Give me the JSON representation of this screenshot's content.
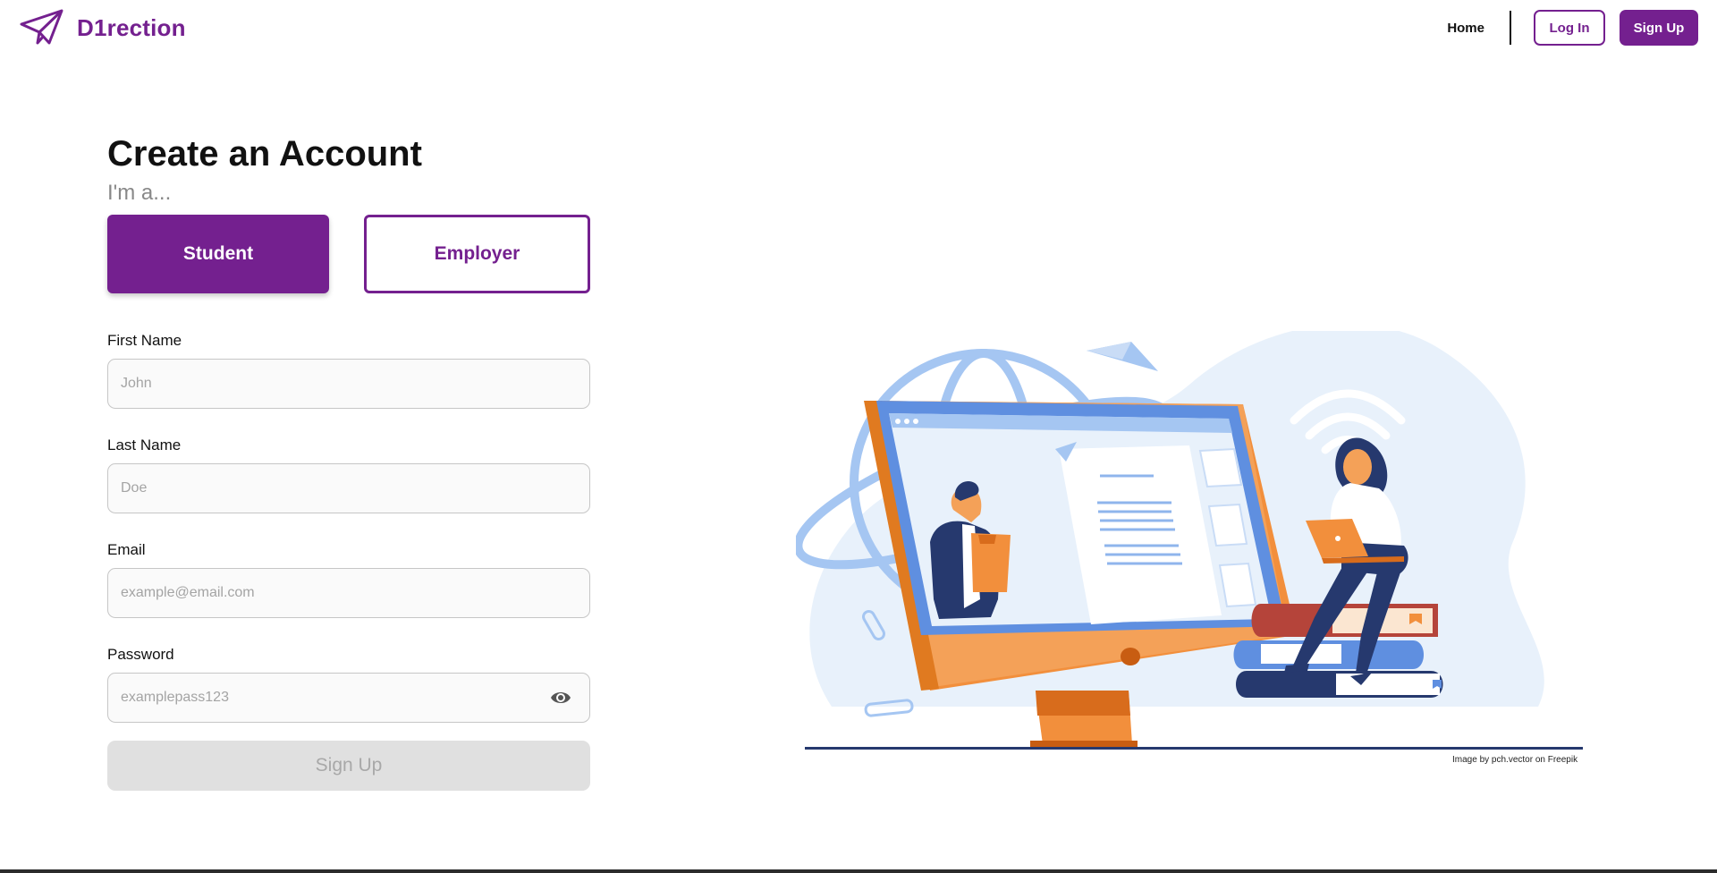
{
  "brand": {
    "name": "D1rection",
    "color": "#74208f"
  },
  "nav": {
    "home": "Home",
    "login": "Log In",
    "signup": "Sign Up"
  },
  "form": {
    "title": "Create an Account",
    "subtitle": "I'm a...",
    "roles": {
      "student": "Student",
      "employer": "Employer",
      "selected": "Student"
    },
    "fields": {
      "first_name": {
        "label": "First Name",
        "placeholder": "John"
      },
      "last_name": {
        "label": "Last Name",
        "placeholder": "Doe"
      },
      "email": {
        "label": "Email",
        "placeholder": "example@email.com"
      },
      "password": {
        "label": "Password",
        "placeholder": "examplepass123"
      }
    },
    "submit": "Sign Up"
  },
  "illustration": {
    "credit": "Image by pch.vector on Freepik",
    "icons": [
      "globe-icon",
      "paper-plane-icon",
      "wifi-icon",
      "monitor-icon",
      "books-icon",
      "laptop-icon",
      "paperclip-icon"
    ]
  },
  "colors": {
    "primary": "#74208f",
    "disabled_bg": "#e0e0e0",
    "disabled_text": "#a8a8a8",
    "input_border": "#c6c6c6"
  }
}
